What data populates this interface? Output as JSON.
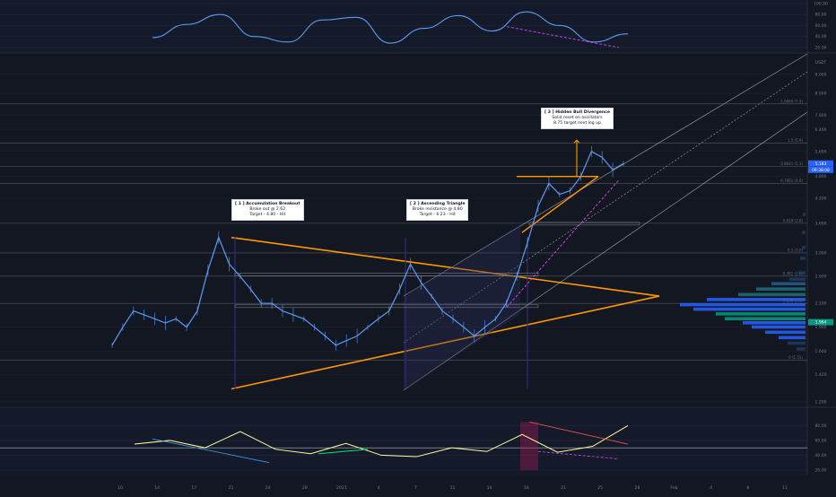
{
  "chart_data": [
    {
      "type": "line",
      "panel": "top oscillator",
      "y_ticks": [
        "100.00",
        "80.00",
        "60.00",
        "40.00",
        "20.00"
      ],
      "ylim": [
        15,
        100
      ],
      "x": [
        0,
        50,
        100,
        150,
        200,
        250,
        300,
        350,
        400,
        450,
        500,
        550,
        600,
        650,
        700
      ],
      "series": [
        {
          "values": [
            38,
            62,
            80,
            40,
            30,
            70,
            75,
            28,
            55,
            78,
            50,
            85,
            60,
            30,
            45
          ],
          "color": "#5b9cf6"
        }
      ],
      "divergence_line": {
        "from": [
          565,
          58
        ],
        "to": [
          690,
          20
        ],
        "color": "#e040fb",
        "style": "dashed"
      },
      "grid": true
    },
    {
      "type": "line",
      "panel": "main price",
      "quote_label": "USDT",
      "y_ticks": [
        "9.000",
        "8.000",
        "7.000",
        "6.400",
        "5.600",
        "4.800",
        "4.200",
        "3.600",
        "3.000",
        "2.600",
        "2.200",
        "1.900",
        "1.640",
        "1.420",
        "1.200"
      ],
      "fib_levels": [
        {
          "label": "1.0046 (7.5)",
          "value": 7.5
        },
        {
          "label": "1.5 (5.9)",
          "value": 5.9
        },
        {
          "label": "0.8641 (5.1)",
          "value": 5.1
        },
        {
          "label": "0.7861 (4.6)",
          "value": 4.6
        },
        {
          "label": "0.618 (3.6)",
          "value": 3.6
        },
        {
          "label": "0.5 (3.0)",
          "value": 3.0
        },
        {
          "label": "0.382 (2.6)",
          "value": 2.6
        },
        {
          "label": "0.236 (2.2)",
          "value": 2.2
        },
        {
          "label": "0 (1.55)",
          "value": 1.55
        }
      ],
      "price_flags": [
        {
          "label": "5.183",
          "color": "#2962ff"
        },
        {
          "label": "09:38:08",
          "color": "#2962ff"
        },
        {
          "label": "1.964",
          "color": "#089981"
        }
      ],
      "series": [
        {
          "values": [
            1.7,
            1.9,
            2.1,
            2.05,
            2.0,
            1.95,
            2.0,
            1.9,
            2.1,
            2.7,
            3.3,
            2.8,
            2.6,
            2.4,
            2.2,
            2.2,
            2.1,
            2.05,
            2.0,
            1.9,
            1.8,
            1.7,
            1.75,
            1.8,
            1.9,
            2.0,
            2.1,
            2.4,
            2.8,
            2.5,
            2.3,
            2.1,
            2.0,
            1.9,
            1.8,
            1.9,
            2.0,
            2.2,
            2.6,
            3.2,
            4.0,
            4.6,
            4.3,
            4.4,
            4.8,
            5.6,
            5.4,
            5.0,
            5.2
          ],
          "color": "#5b9cf6"
        }
      ],
      "annotations": [
        {
          "title": "[ 1 ] Accumulation Breakout",
          "lines": [
            "Broke out @ 2.62",
            "Target - 4.80 - Hit"
          ]
        },
        {
          "title": "[ 2 ] Ascending Triangle",
          "lines": [
            "Broke resistance @ 4.80",
            "Target - 6.23 - Hit"
          ]
        },
        {
          "title": "[ 3 ] Hidden Bull Divergence",
          "lines": [
            "Solid reset on oscillators",
            "8.75 target next leg up"
          ]
        }
      ],
      "grid": true
    },
    {
      "type": "line",
      "panel": "bottom oscillator",
      "y_ticks": [
        "80.00",
        "60.00",
        "40.00",
        "20.00"
      ],
      "ylim": [
        15,
        100
      ],
      "x": [
        0,
        40,
        80,
        120,
        160,
        200,
        240,
        280,
        320,
        360,
        400,
        440,
        480,
        520,
        560
      ],
      "series": [
        {
          "values": [
            55,
            60,
            50,
            72,
            48,
            42,
            56,
            40,
            38,
            50,
            45,
            68,
            44,
            52,
            80
          ],
          "color": "#ffff99"
        }
      ],
      "x_ticks": [
        "10",
        "14",
        "17",
        "21",
        "24",
        "28",
        "2021",
        "4",
        "7",
        "11",
        "14",
        "18",
        "21",
        "25",
        "28",
        "Feb",
        "4",
        "8",
        "11"
      ],
      "grid": true
    }
  ]
}
